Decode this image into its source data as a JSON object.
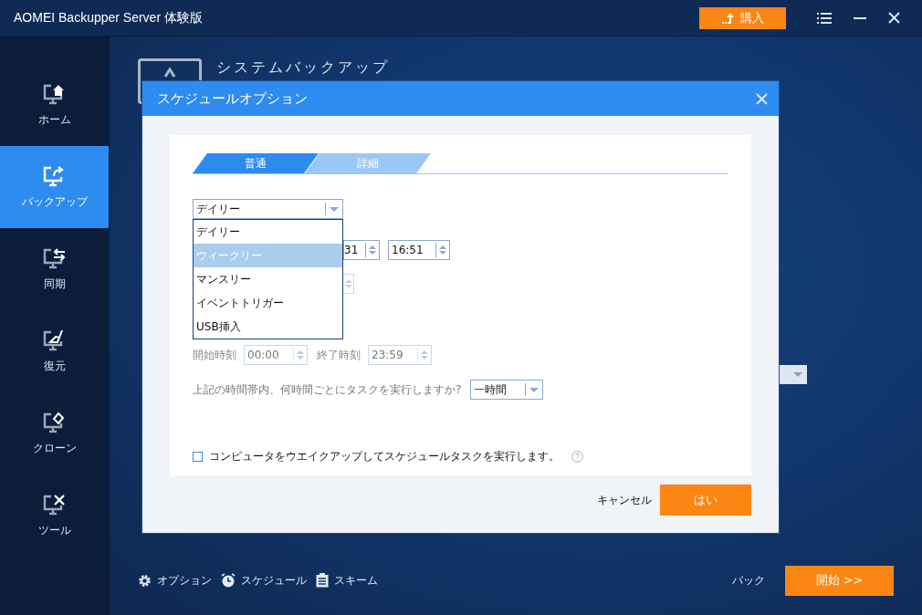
{
  "window": {
    "title": "AOMEI Backupper Server 体験版",
    "purchase_label": "購入"
  },
  "sidebar": {
    "items": [
      {
        "kind": "home",
        "label": "ホーム",
        "selected": false
      },
      {
        "kind": "backup",
        "label": "バックアップ",
        "selected": true
      },
      {
        "kind": "sync",
        "label": "同期",
        "selected": false
      },
      {
        "kind": "restore",
        "label": "復元",
        "selected": false
      },
      {
        "kind": "clone",
        "label": "クローン",
        "selected": false
      },
      {
        "kind": "tools",
        "label": "ツール",
        "selected": false
      }
    ]
  },
  "main": {
    "title": "システムバックアップ"
  },
  "dialog": {
    "title": "スケジュールオプション",
    "tabs": [
      {
        "label": "普通",
        "selected": true
      },
      {
        "label": "詳細",
        "selected": false
      }
    ],
    "frequency": {
      "value": "デイリー",
      "expanded": true,
      "options": [
        {
          "label": "デイリー",
          "highlighted": false
        },
        {
          "label": "ウィークリー",
          "highlighted": true
        },
        {
          "label": "マンスリー",
          "highlighted": false
        },
        {
          "label": "イベントトリガー",
          "highlighted": false
        },
        {
          "label": "USB挿入",
          "highlighted": false
        }
      ]
    },
    "date_value": "31",
    "time_value": "16:51",
    "start_time": {
      "label": "開始時刻",
      "value": "00:00",
      "disabled": true
    },
    "end_time": {
      "label": "終了時刻",
      "value": "23:59",
      "disabled": true
    },
    "interval": {
      "question": "上記の時間帯内、何時間ごとにタスクを実行しますか?",
      "value": "一時間"
    },
    "wake_option": {
      "label": "コンピュータをウエイクアップしてスケジュールタスクを実行します。",
      "checked": false
    },
    "cancel_label": "キャンセル",
    "ok_label": "はい"
  },
  "bottom_bar": {
    "links": [
      {
        "kind": "options",
        "label": "オプション"
      },
      {
        "kind": "schedule",
        "label": "スケジュール"
      },
      {
        "kind": "scheme",
        "label": "スキーム"
      }
    ],
    "back_label": "バック",
    "start_label": "開始 >>"
  }
}
